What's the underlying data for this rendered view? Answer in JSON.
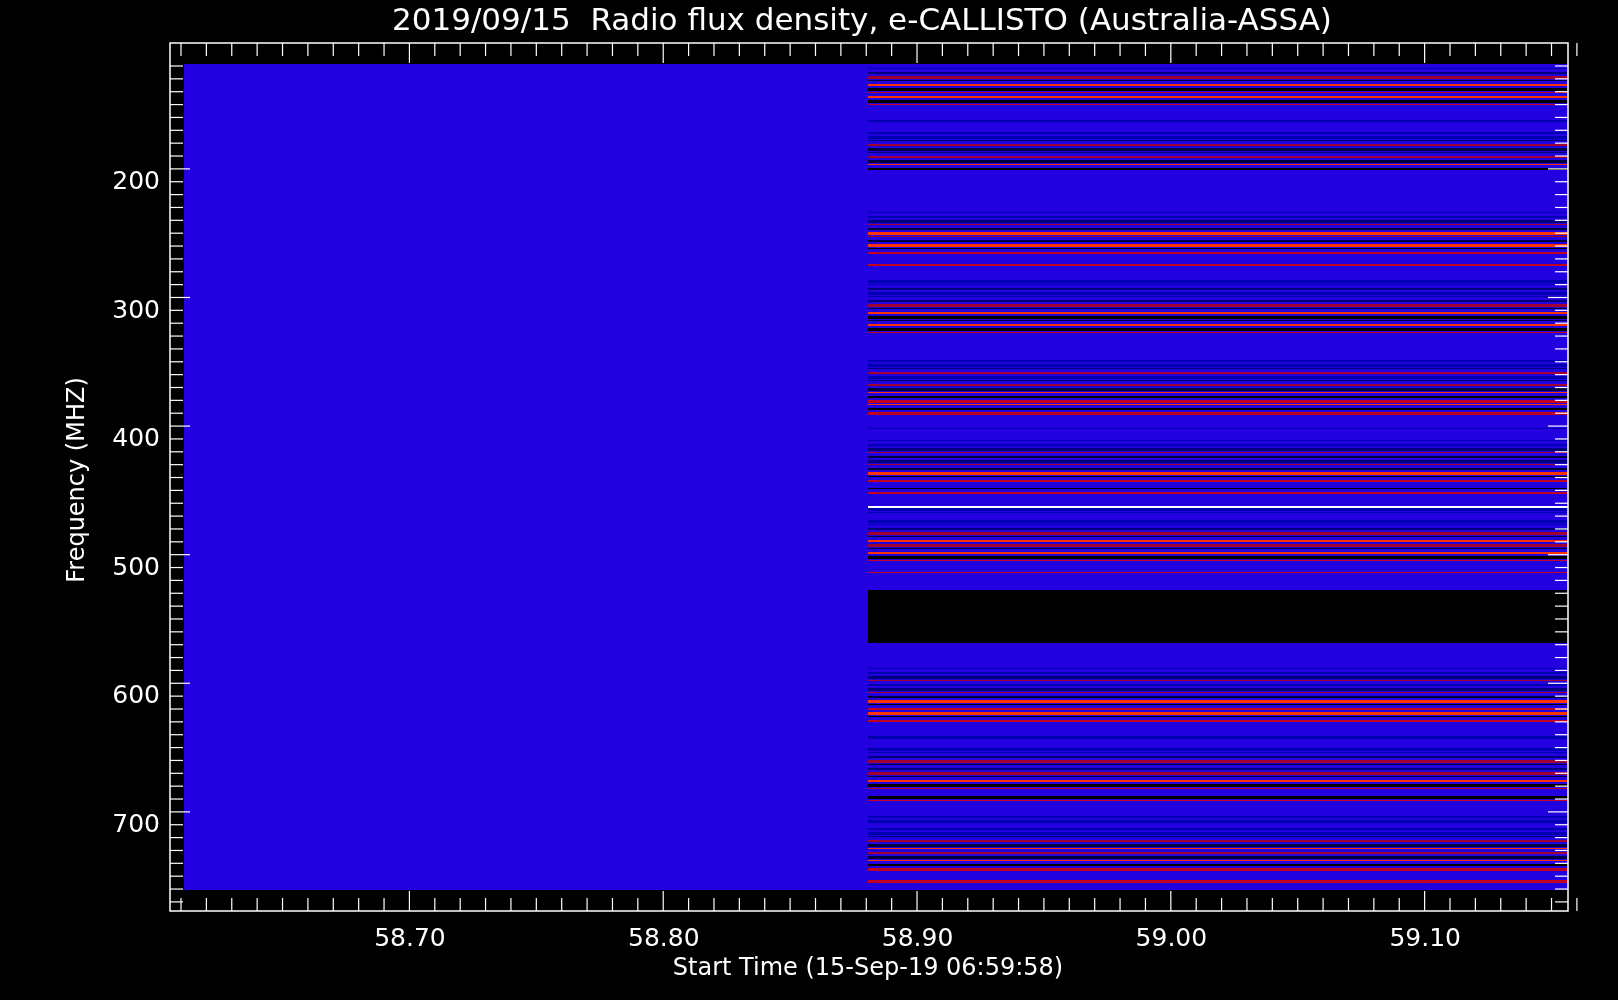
{
  "title": "2019/09/15  Radio flux density, e-CALLISTO (Australia-ASSA)",
  "y_axis": {
    "label": "Frequency (MHZ)",
    "ticks": [
      "200",
      "300",
      "400",
      "500",
      "600",
      "700"
    ]
  },
  "x_axis": {
    "label": "Start Time (15-Sep-19 06:59:58)",
    "ticks": [
      "58.70",
      "58.80",
      "58.90",
      "59.00",
      "59.10"
    ]
  }
}
